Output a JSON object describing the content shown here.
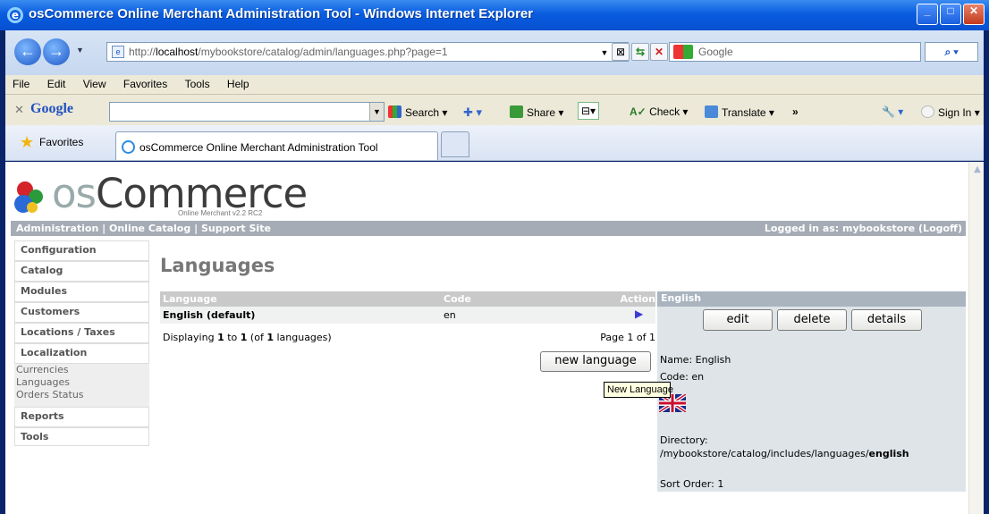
{
  "window": {
    "title": "osCommerce Online Merchant Administration Tool - Windows Internet Explorer"
  },
  "address": {
    "url_prefix": "http://",
    "url_host": "localhost",
    "url_path": "/mybookstore/catalog/admin/languages.php?page=1",
    "search_placeholder": "Google"
  },
  "menu": [
    "File",
    "Edit",
    "View",
    "Favorites",
    "Tools",
    "Help"
  ],
  "google_toolbar": {
    "logo": "Google",
    "search": "Search",
    "share": "Share",
    "check": "Check",
    "translate": "Translate",
    "more": "»",
    "sign_in": "Sign In"
  },
  "favorites": {
    "label": "Favorites",
    "tab_title": "osCommerce Online Merchant Administration Tool"
  },
  "header": {
    "logo_text_os": "os",
    "logo_text_commerce": "Commerce",
    "version": "Online Merchant v2.2 RC2",
    "links": [
      "Administration",
      "Online Catalog",
      "Support Site"
    ],
    "logged_in": "Logged in as: mybookstore (Logoff)"
  },
  "sidebar": {
    "boxes": [
      "Configuration",
      "Catalog",
      "Modules",
      "Customers",
      "Locations / Taxes",
      "Localization"
    ],
    "localization_items": [
      "Currencies",
      "Languages",
      "Orders Status"
    ],
    "boxes_after": [
      "Reports",
      "Tools"
    ]
  },
  "main": {
    "page_title": "Languages",
    "columns": [
      "Language",
      "Code",
      "Action"
    ],
    "rows": [
      {
        "language": "English (default)",
        "code": "en"
      }
    ],
    "displaying_prefix": "Displaying ",
    "displaying_from": "1",
    "displaying_to_word": " to ",
    "displaying_to": "1",
    "displaying_of": " (of ",
    "displaying_total": "1",
    "displaying_suffix": " languages)",
    "page_info": "Page 1 of 1",
    "new_language_button": "new language",
    "tooltip": "New Language"
  },
  "info_panel": {
    "heading": "English",
    "buttons": [
      "edit",
      "delete",
      "details"
    ],
    "name": "Name: English",
    "code": "Code: en",
    "directory_label": "Directory:",
    "directory_path": "/mybookstore/catalog/includes/languages/",
    "directory_bold": "english",
    "sort_order": "Sort Order: 1"
  },
  "colors": {
    "header_bar": "#a6acb5",
    "panel_bg": "#dee4e8",
    "panel_header": "#aab4bf",
    "row_arrow": "#3b3bd6"
  }
}
